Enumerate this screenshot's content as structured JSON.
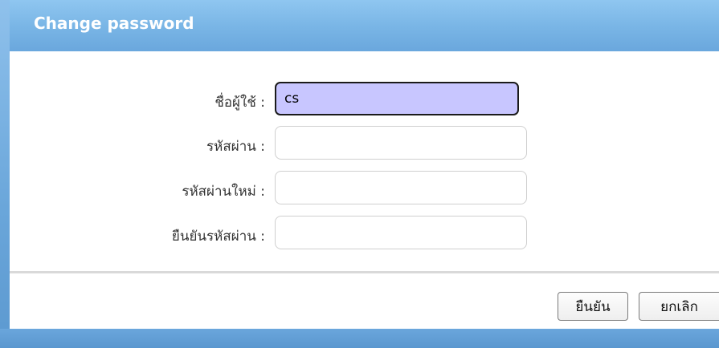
{
  "window": {
    "title": "Change password"
  },
  "form": {
    "fields": [
      {
        "label": "ชื่อผู้ใช้ :",
        "value": "cs",
        "placeholder": ""
      },
      {
        "label": "รหัสผ่าน :",
        "value": "",
        "placeholder": ""
      },
      {
        "label": "รหัสผ่านใหม่ :",
        "value": "",
        "placeholder": ""
      },
      {
        "label": "ยืนยันรหัสผ่าน :",
        "value": "",
        "placeholder": ""
      }
    ]
  },
  "actions": {
    "confirm_label": "ยืนยัน",
    "cancel_label": "ยกเลิก"
  },
  "colors": {
    "titlebar": "#7ab6e6",
    "active_field": "#c8c6ff"
  }
}
